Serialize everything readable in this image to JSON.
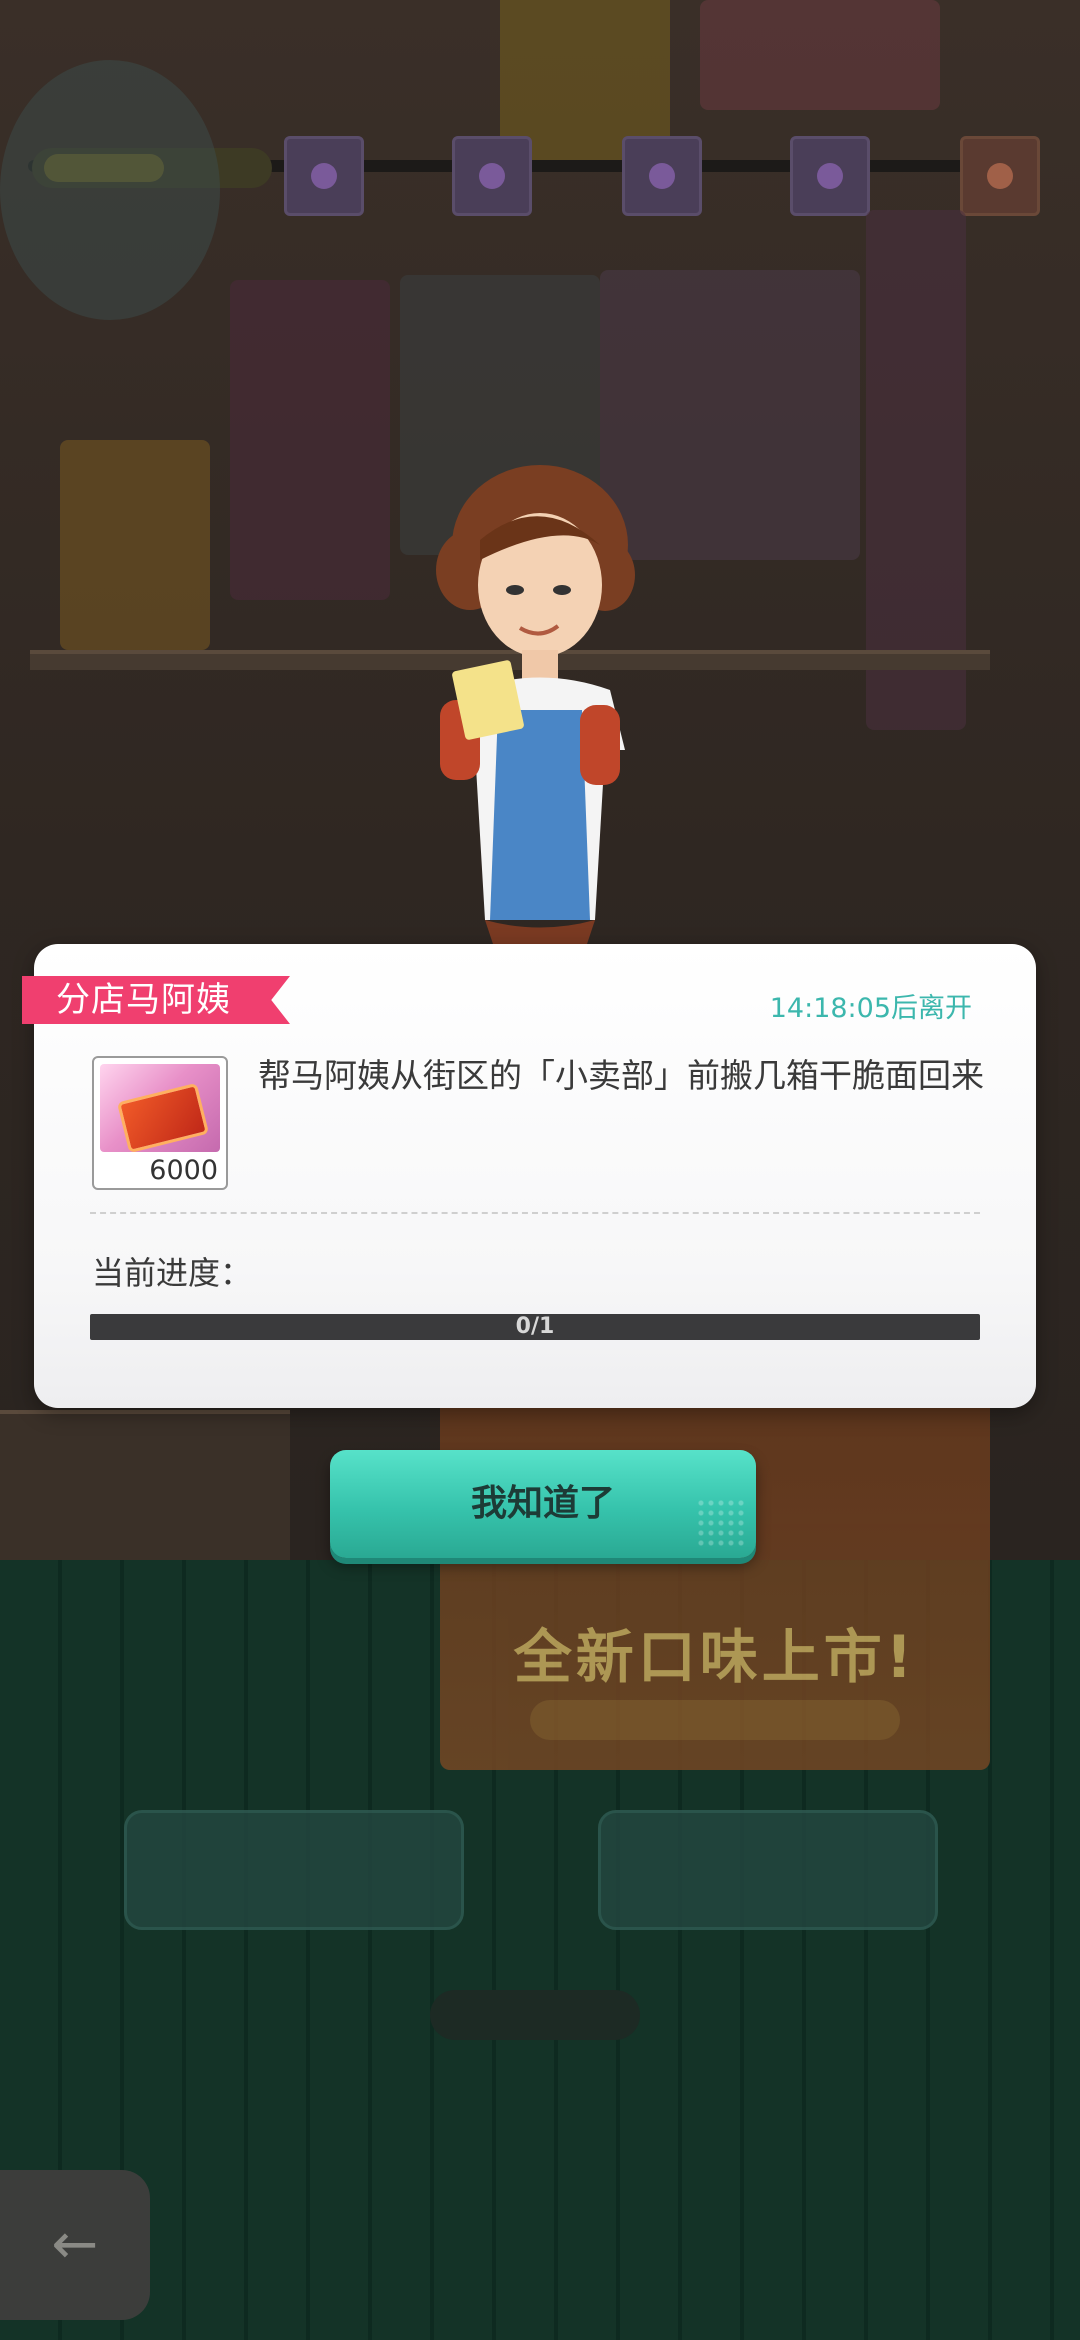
{
  "dialog": {
    "npc_name": "分店马阿姨",
    "leave_timer": "14:18:05后离开",
    "task_description": "帮马阿姨从街区的「小卖部」前搬几箱干脆面回来",
    "reward": {
      "icon": "ticket-card-icon",
      "count": "6000"
    },
    "progress_label": "当前进度：",
    "progress_text": "0/1",
    "progress_fraction": 0
  },
  "confirm_button": {
    "label": "我知道了"
  },
  "background": {
    "poster_slogan": "全新口味上市!",
    "back_icon": "back-arrow-icon"
  },
  "colors": {
    "accent_teal": "#36c3ac",
    "tag_pink": "#f03f6f",
    "timer_teal": "#3cb7ad"
  }
}
